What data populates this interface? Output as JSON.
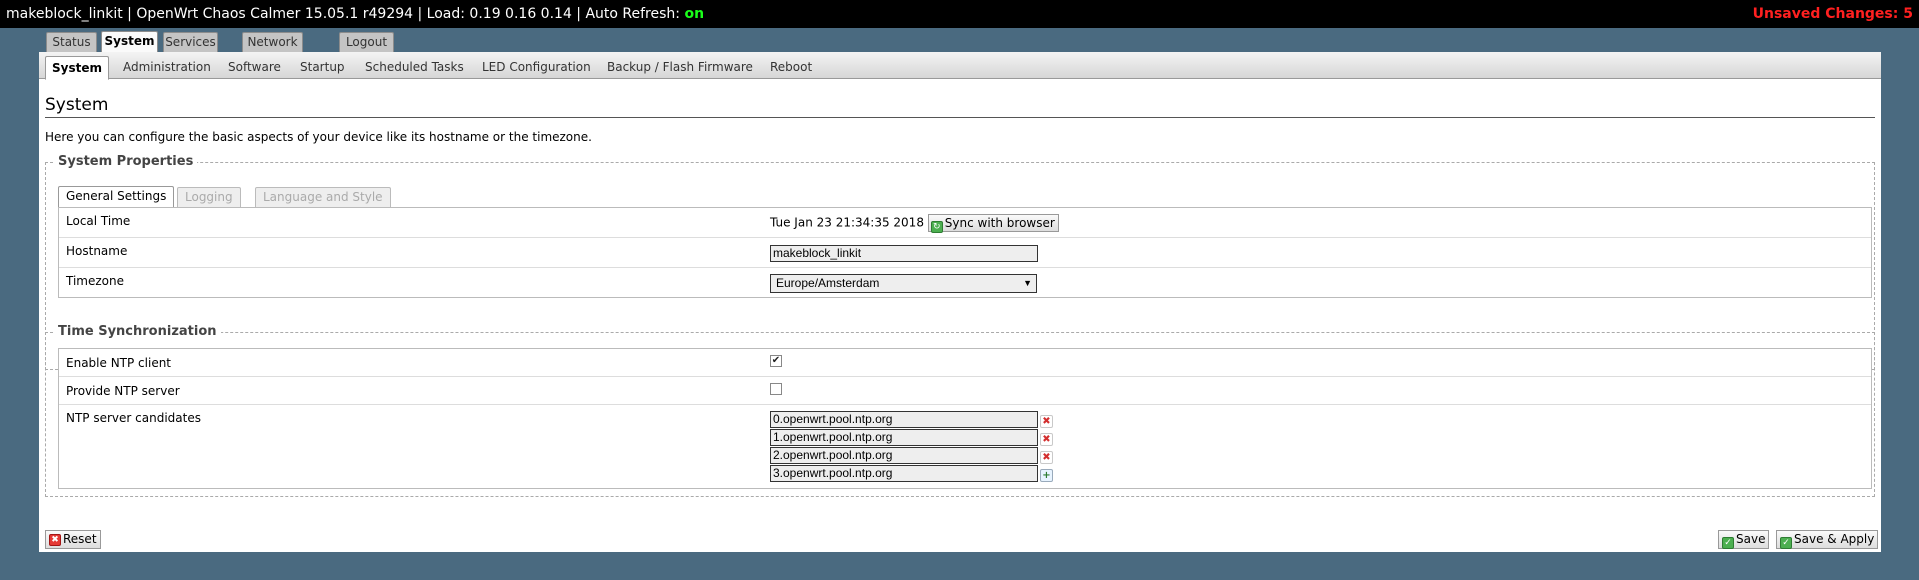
{
  "header": {
    "title": "makeblock_linkit | OpenWrt Chaos Calmer 15.05.1 r49294 | Load: 0.19 0.16 0.14 | Auto Refresh:",
    "auto_refresh": "on",
    "unsaved_label": "Unsaved Changes:",
    "unsaved_count": "5"
  },
  "main_tabs": [
    "Status",
    "System",
    "Services",
    "Network",
    "Logout"
  ],
  "sub_tabs": [
    "System",
    "Administration",
    "Software",
    "Startup",
    "Scheduled Tasks",
    "LED Configuration",
    "Backup / Flash Firmware",
    "Reboot"
  ],
  "page": {
    "title": "System",
    "description": "Here you can configure the basic aspects of your device like its hostname or the timezone."
  },
  "system_properties": {
    "legend": "System Properties",
    "tabs": [
      "General Settings",
      "Logging",
      "Language and Style"
    ],
    "local_time_label": "Local Time",
    "local_time_value": "Tue Jan 23 21:34:35 2018",
    "sync_button": "Sync with browser",
    "hostname_label": "Hostname",
    "hostname_value": "makeblock_linkit",
    "timezone_label": "Timezone",
    "timezone_value": "Europe/Amsterdam"
  },
  "time_sync": {
    "legend": "Time Synchronization",
    "enable_ntp_label": "Enable NTP client",
    "enable_ntp_checked": true,
    "provide_ntp_label": "Provide NTP server",
    "provide_ntp_checked": false,
    "candidates_label": "NTP server candidates",
    "candidates": [
      "0.openwrt.pool.ntp.org",
      "1.openwrt.pool.ntp.org",
      "2.openwrt.pool.ntp.org",
      "3.openwrt.pool.ntp.org"
    ]
  },
  "footer": {
    "reset": "Reset",
    "save": "Save",
    "save_apply": "Save & Apply"
  }
}
